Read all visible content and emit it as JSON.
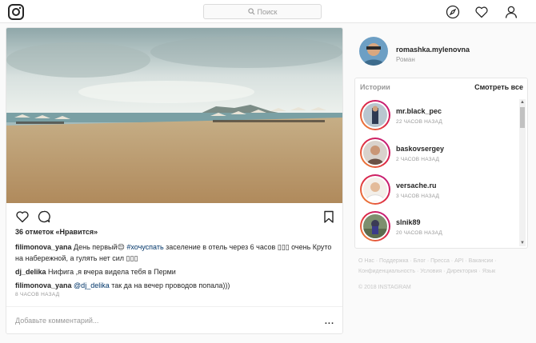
{
  "header": {
    "search_placeholder": "Поиск"
  },
  "post": {
    "likes": "36 отметок «Нравится»",
    "comments": [
      {
        "user": "filimonova_yana",
        "text_before": "День первый😌 ",
        "tag": "#хочуспать",
        "text_after": " заселение в отель через 6 часов ▯▯▯ очень Круто на набережной, а гулять нет сил ▯▯▯"
      },
      {
        "user": "dj_delika",
        "text_before": "Нифига ,я вчера видела тебя в Перми",
        "tag": "",
        "text_after": ""
      },
      {
        "user": "filimonova_yana",
        "text_before": "",
        "tag": "@dj_delika",
        "text_after": " так да на вечер проводов попала)))"
      }
    ],
    "time": "8 ЧАСОВ НАЗАД",
    "add_comment_placeholder": "Добавьте комментарий...",
    "more": "..."
  },
  "profile": {
    "username": "romashka.mylenovna",
    "name": "Роман"
  },
  "stories": {
    "title": "Истории",
    "see_all": "Смотреть все",
    "items": [
      {
        "user": "mr.black_pec",
        "time": "22 ЧАСОВ НАЗАД"
      },
      {
        "user": "baskovsergey",
        "time": "2 ЧАСОВ НАЗАД"
      },
      {
        "user": "versache.ru",
        "time": "3 ЧАСОВ НАЗАД"
      },
      {
        "user": "slnik89",
        "time": "20 ЧАСОВ НАЗАД"
      }
    ]
  },
  "footer": {
    "links": "О Нас · Поддержка · Блог · Пресса · API · Вакансии · Конфиденциальность · Условия · Директория · Язык",
    "copyright": "© 2018 INSTAGRAM"
  }
}
